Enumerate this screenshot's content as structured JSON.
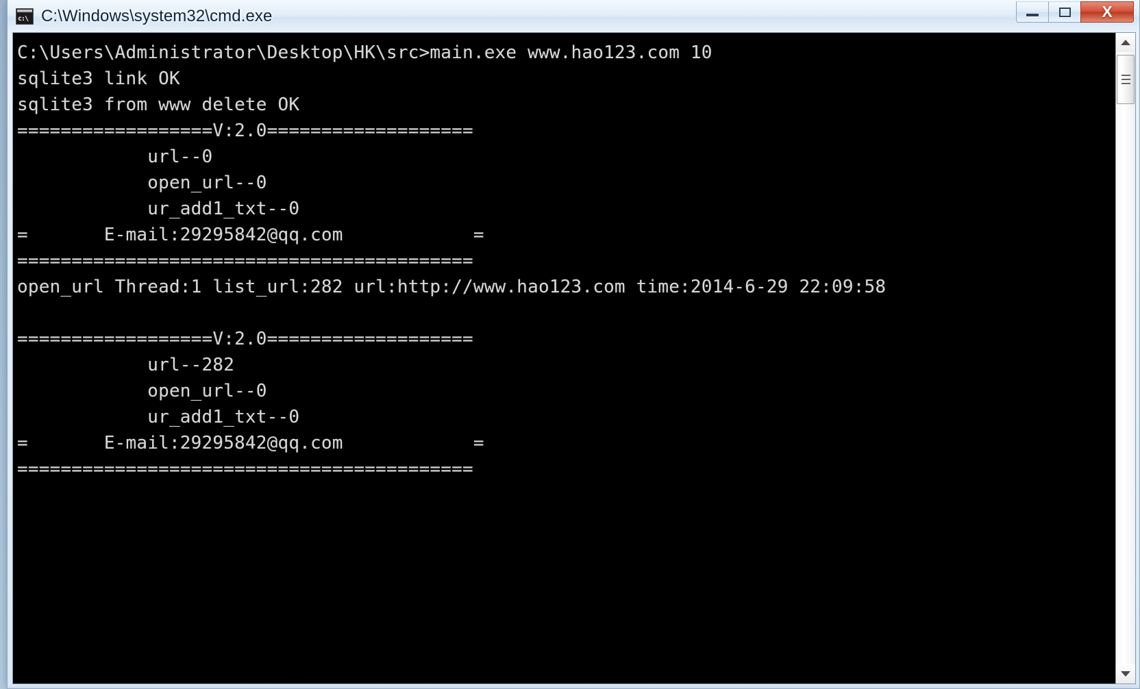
{
  "window": {
    "title": "C:\\Windows\\system32\\cmd.exe",
    "icon": "cmd-icon",
    "icon_glyph": "c:\\",
    "controls": {
      "minimize_label": "—",
      "maximize_label": "□",
      "close_label": "X",
      "minimize_name": "minimize-button",
      "maximize_name": "maximize-button",
      "close_name": "close-button"
    }
  },
  "console": {
    "background_color": "#000000",
    "text_color": "#d6d6d6",
    "lines": [
      "C:\\Users\\Administrator\\Desktop\\HK\\src>main.exe www.hao123.com 10",
      "sqlite3 link OK",
      "sqlite3 from www delete OK",
      "==================V:2.0===================",
      "            url--0",
      "            open_url--0",
      "            ur_add1_txt--0",
      "=       E-mail:29295842@qq.com            =",
      "==========================================",
      "open_url Thread:1 list_url:282 url:http://www.hao123.com time:2014-6-29 22:09:58",
      "",
      "==================V:2.0===================",
      "            url--282",
      "            open_url--0",
      "            ur_add1_txt--0",
      "=       E-mail:29295842@qq.com            =",
      "=========================================="
    ],
    "command": "main.exe www.hao123.com 10",
    "prompt_path": "C:\\Users\\Administrator\\Desktop\\HK\\src>",
    "version_banner": "V:2.0",
    "email": "29295842@qq.com",
    "status_messages": [
      "sqlite3 link OK",
      "sqlite3 from www delete OK"
    ],
    "counters_first": {
      "url": "0",
      "open_url": "0",
      "ur_add1_txt": "0"
    },
    "counters_second": {
      "url": "282",
      "open_url": "0",
      "ur_add1_txt": "0"
    },
    "thread_record": {
      "thread": "1",
      "list_url": "282",
      "url": "http://www.hao123.com",
      "time": "2014-6-29 22:09:58"
    }
  },
  "scrollbar": {
    "up_arrow": "scroll-up-arrow-icon",
    "down_arrow": "scroll-down-arrow-icon",
    "thumb": "scroll-thumb"
  }
}
